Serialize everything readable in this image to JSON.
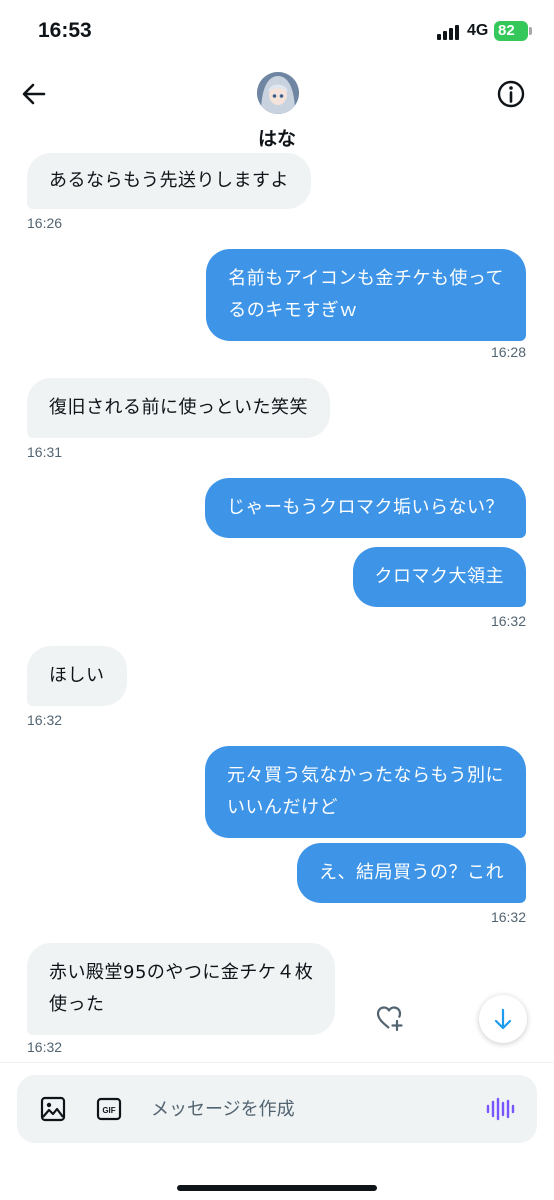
{
  "status_bar": {
    "time": "16:53",
    "network": "4G",
    "battery": "82"
  },
  "header": {
    "contact_name": "はな"
  },
  "messages": [
    {
      "dir": "in",
      "text": "あるならもう先送りしますよ"
    },
    {
      "dir": "in",
      "time": "16:26"
    },
    {
      "dir": "out",
      "line1": "名前もアイコンも金チケも使って",
      "line2": "るのキモすぎｗ"
    },
    {
      "dir": "out",
      "time": "16:28"
    },
    {
      "dir": "in",
      "text": "復旧される前に使っといた笑笑"
    },
    {
      "dir": "in",
      "time": "16:31"
    },
    {
      "dir": "out",
      "text": "じゃーもうクロマク垢いらない？"
    },
    {
      "dir": "out",
      "text": "クロマク大領主"
    },
    {
      "dir": "out",
      "time": "16:32"
    },
    {
      "dir": "in",
      "text": "ほしい"
    },
    {
      "dir": "in",
      "time": "16:32"
    },
    {
      "dir": "out",
      "line1": "元々買う気なかったならもう別に",
      "line2": "いいんだけど"
    },
    {
      "dir": "out",
      "text": "え、結局買うの？これ"
    },
    {
      "dir": "out",
      "time": "16:32"
    },
    {
      "dir": "in",
      "line1": "赤い殿堂95のやつに金チケ４枚",
      "line2": "使った"
    },
    {
      "dir": "in",
      "time": "16:32"
    }
  ],
  "composer": {
    "placeholder": "メッセージを作成",
    "gif_label": "GIF"
  },
  "icons": {
    "back": "arrow-left-icon",
    "info": "info-circle-icon",
    "react": "heart-plus-icon",
    "scroll": "arrow-down-icon",
    "image": "image-icon",
    "gif": "gif-icon",
    "voice": "voice-wave-icon"
  },
  "colors": {
    "outgoing_bubble": "#3e95e8",
    "incoming_bubble": "#eff3f4",
    "accent": "#1d9bf0",
    "voice": "#7856ff",
    "battery": "#34c759"
  }
}
